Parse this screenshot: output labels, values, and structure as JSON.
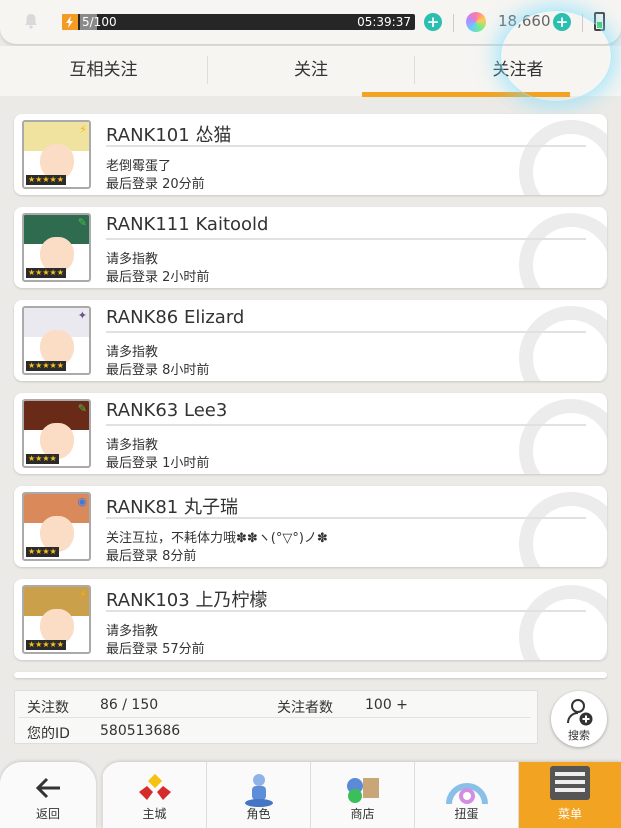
{
  "status_bar": {
    "stamina": "5/100",
    "stamina_fraction": 0.05,
    "timer": "05:39:37",
    "gems": "18,660"
  },
  "tabs": [
    {
      "label": "互相关注",
      "active": false
    },
    {
      "label": "关注",
      "active": false
    },
    {
      "label": "关注者",
      "active": true
    }
  ],
  "friends": [
    {
      "name": "RANK101 怂猫",
      "message": "老倒霉蛋了",
      "login": "最后登录 20分前",
      "stars": "★★★★★",
      "hair": "#f0e3a0",
      "attr": "⚡",
      "attr_color": "#f3b21b"
    },
    {
      "name": "RANK111 Kaitoold",
      "message": "请多指教",
      "login": "最后登录 2小时前",
      "stars": "★★★★★",
      "hair": "#2f6b4e",
      "attr": "✎",
      "attr_color": "#49c049"
    },
    {
      "name": "RANK86 Elizard",
      "message": "请多指教",
      "login": "最后登录 8小时前",
      "stars": "★★★★★",
      "hair": "#e9e9ef",
      "attr": "✦",
      "attr_color": "#6b4e8a"
    },
    {
      "name": "RANK63 Lee3",
      "message": "请多指教",
      "login": "最后登录 1小时前",
      "stars": "★★★★",
      "hair": "#6a2a18",
      "attr": "✎",
      "attr_color": "#49c049"
    },
    {
      "name": "RANK81 丸子瑞",
      "message": "关注互拉，不耗体力哦✽✽ヽ(°▽°)ノ✽",
      "login": "最后登录 8分前",
      "stars": "★★★★",
      "hair": "#d9895a",
      "attr": "◉",
      "attr_color": "#3a7be0"
    },
    {
      "name": "RANK103 上乃柠檬",
      "message": "请多指教",
      "login": "最后登录 57分前",
      "stars": "★★★★★",
      "hair": "#caa04a",
      "attr": "⚡",
      "attr_color": "#f3b21b"
    }
  ],
  "info": {
    "following_label": "关注数",
    "following_value": "86 / 150",
    "followers_label": "关注者数",
    "followers_value": "100 +",
    "id_label": "您的ID",
    "id_value": "580513686"
  },
  "search_label": "搜索",
  "nav": [
    {
      "label": "返回",
      "icon": "back-arrow-icon"
    },
    {
      "label": "主城",
      "icon": "town-icon"
    },
    {
      "label": "角色",
      "icon": "character-icon"
    },
    {
      "label": "商店",
      "icon": "shop-icon"
    },
    {
      "label": "扭蛋",
      "icon": "gacha-icon"
    },
    {
      "label": "菜单",
      "icon": "menu-icon",
      "active": true
    }
  ],
  "colors": {
    "accent": "#f2a321",
    "plus": "#2bbfb0"
  }
}
